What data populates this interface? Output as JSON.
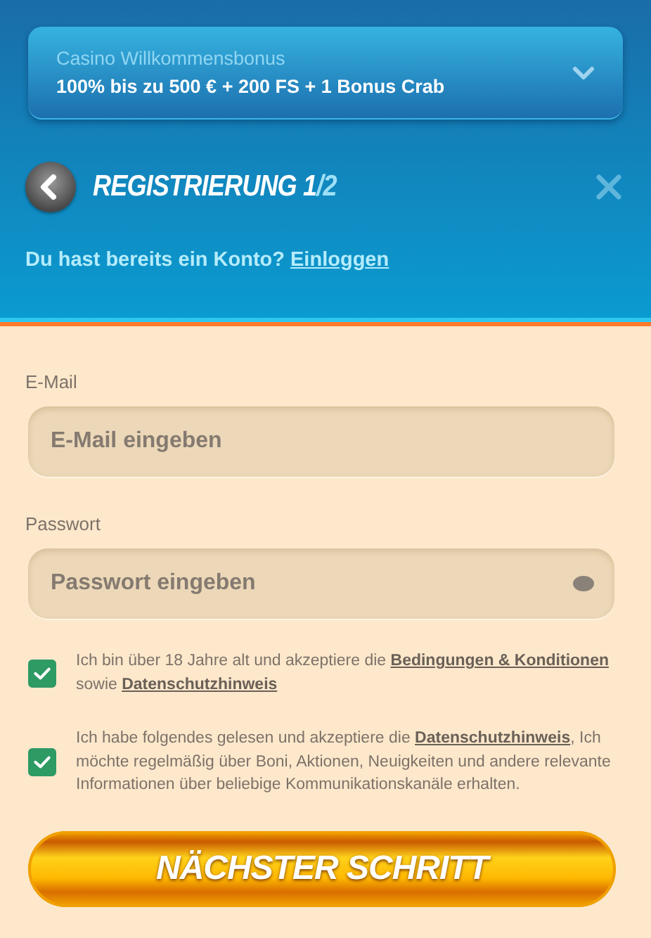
{
  "bonus": {
    "title": "Casino Willkommensbonus",
    "offer": "100% bis zu 500 € + 200 FS + 1 Bonus Crab",
    "expanded": false
  },
  "header": {
    "title": "REGISTRIERUNG 1",
    "title_suffix": "/2"
  },
  "login_prompt": {
    "text": "Du hast bereits ein Konto?",
    "link": "Einloggen"
  },
  "fields": [
    {
      "label": "E-Mail",
      "placeholder": "E-Mail eingeben",
      "kind": "email"
    },
    {
      "label": "Passwort",
      "placeholder": "Passwort eingeben",
      "kind": "password"
    }
  ],
  "consents": [
    {
      "checked": true,
      "parts": [
        {
          "kind": "text",
          "text": "Ich bin über 18 Jahre alt und akzeptiere die "
        },
        {
          "kind": "link",
          "text": "Bedingungen & Konditionen"
        },
        {
          "kind": "text",
          "text": " sowie "
        },
        {
          "kind": "link",
          "text": "Datenschutzhinweis"
        }
      ]
    },
    {
      "checked": true,
      "parts": [
        {
          "kind": "text",
          "text": "Ich habe folgendes gelesen und akzeptiere die "
        },
        {
          "kind": "link",
          "text": "Datenschutzhinweis"
        },
        {
          "kind": "text",
          "text": ", Ich möchte regelmäßig über Boni, Aktionen, Neuigkeiten und andere relevante Informationen über beliebige Kommunikationskanäle erhalten."
        }
      ]
    }
  ],
  "submit": "NÄCHSTER SCHRITT"
}
